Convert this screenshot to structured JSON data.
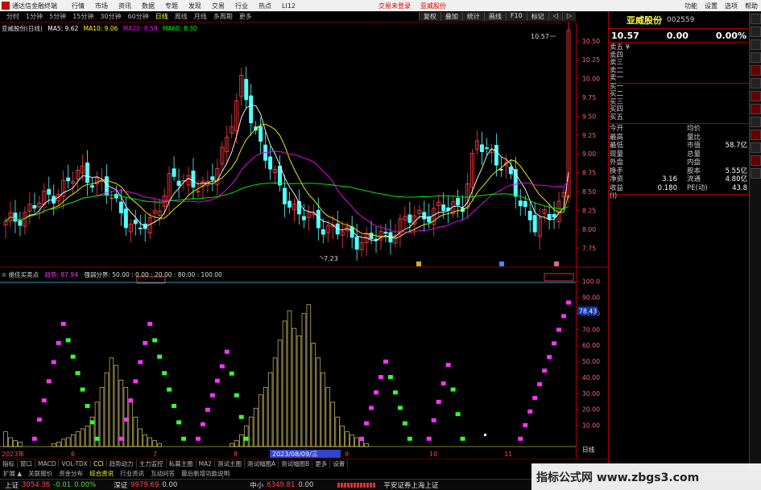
{
  "menu": {
    "app_title": "通达信金融终端",
    "items": [
      "行情",
      "市场",
      "资讯",
      "数据",
      "专题",
      "发现",
      "交易",
      "行业",
      "热点",
      "LI12"
    ],
    "alert1": "交易未登录",
    "alert2": "亚威股份",
    "right": [
      "功能",
      "设置",
      "选项",
      "帮助"
    ]
  },
  "toolbar": {
    "periods": [
      "分时",
      "1分钟",
      "5分钟",
      "15分钟",
      "30分钟",
      "60分钟",
      "日线",
      "周线",
      "月线",
      "多周期",
      "更多"
    ],
    "active": "日线",
    "right_buttons": [
      "复权",
      "叠加",
      "统计",
      "画线",
      "F10",
      "标记",
      "◁",
      "▷"
    ]
  },
  "legend_main": {
    "title": "亚威股份(日线)",
    "ma5": "MA5: 9.62",
    "ma10": "MA10: 9.06",
    "ma20": "MA20: 8.59",
    "ma60": "MA60: 8.30"
  },
  "legend_ind": {
    "title": "绝佳买卖点",
    "trend": "趋势: 87.94",
    "line": "强弱分界: 50.00 : 0.00 : 20.00 : 80.00 : 100.00"
  },
  "price_axis": [
    "10.50",
    "10.25",
    "10.00",
    "9.75",
    "9.50",
    "9.25",
    "9.00",
    "8.75",
    "8.50",
    "8.25",
    "8.00",
    "7.75"
  ],
  "ind_axis": [
    "100.0",
    "90.00",
    "80.00",
    "70.00",
    "60.00",
    "50.00",
    "40.00",
    "30.00",
    "20.00",
    "10.00"
  ],
  "ind_current": "78.43",
  "annotations": {
    "high": "10.57",
    "low": "7.23",
    "date_cursor": "2023/08/09/三",
    "axis_year": "2023年",
    "month_labels": [
      "6",
      "7",
      "8",
      "9",
      "10",
      "11"
    ],
    "axis_unit": "日线"
  },
  "quote": {
    "name": "亚威股份",
    "code": "002559",
    "price": "10.57",
    "change": "0.00",
    "pct": "0.00%",
    "order_book": [
      "卖五 ¥",
      "卖四",
      "卖三",
      "卖二",
      "卖一",
      "买一",
      "买二",
      "买三",
      "买四",
      "买五"
    ],
    "stats": [
      {
        "l": "今开",
        "v": "",
        "l2": "均价",
        "v2": ""
      },
      {
        "l": "最高",
        "v": "",
        "l2": "量比",
        "v2": ""
      },
      {
        "l": "最低",
        "v": "",
        "l2": "市值",
        "v2": "58.7亿"
      },
      {
        "l": "现量",
        "v": "",
        "l2": "总量",
        "v2": ""
      },
      {
        "l": "外盘",
        "v": "",
        "l2": "内盘",
        "v2": ""
      },
      {
        "l": "换手",
        "v": "",
        "l2": "股本",
        "v2": "5.55亿"
      },
      {
        "l": "净资",
        "v": "3.16",
        "l2": "流通",
        "v2": "4.80亿"
      },
      {
        "l": "收益(Ⅰ)",
        "v": "0.180",
        "l2": "PE(动)",
        "v2": "43.8"
      }
    ]
  },
  "tabs": [
    "指标",
    "窗口",
    "MACD",
    "VOL-TDX",
    "CCI",
    "趋势动力",
    "主力监控",
    "私募主图",
    "MA2",
    "测试主图",
    "测试幅图A",
    "测试幅图B",
    "更多",
    "设置"
  ],
  "tabs_active": "CCI",
  "tabs2": [
    "扩展 ▲",
    "关联报价",
    "资金分布",
    "综合资讯",
    "行业资讯",
    "互动问答",
    "最后新增功能说明"
  ],
  "status": {
    "sh_label": "上证",
    "sh_val": "3054.36",
    "sh_chg": "-0.01",
    "sh_pct": "0.00%",
    "sz_label": "深证",
    "sz_val": "9979.69",
    "sz_chg": "0.00",
    "zx_label": "中小",
    "zx_val": "6349.81",
    "zx_chg": "0.00",
    "broker": "平安证券上海上证"
  },
  "watermark": "指标公式网 www.zbgs3.com",
  "colors": {
    "up": "#ff4040",
    "down": "#54ffff",
    "ma5": "#ffffff",
    "ma10": "#ffff00",
    "ma20": "#ff00ff",
    "ma60": "#00ff00",
    "pink": "#ff33ff",
    "green": "#33ff33",
    "vol": "#d8c870"
  }
}
